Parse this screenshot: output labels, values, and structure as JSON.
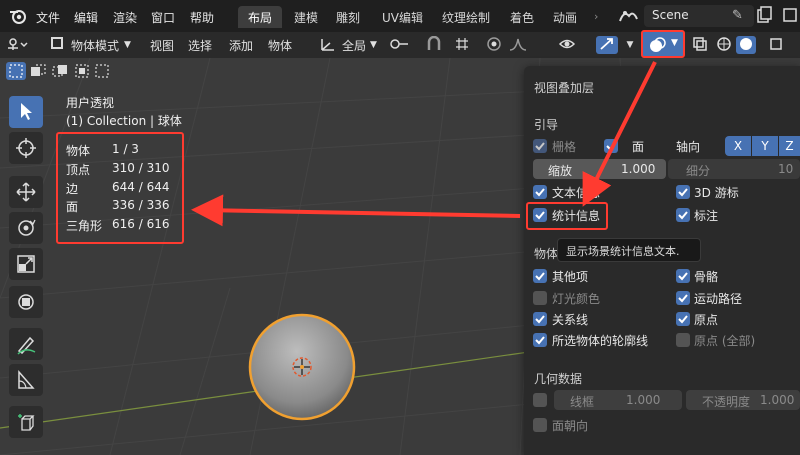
{
  "menubar": {
    "items": [
      "文件",
      "编辑",
      "渲染",
      "窗口",
      "帮助"
    ],
    "workspaces": [
      "布局",
      "建模",
      "雕刻",
      "UV编辑",
      "纹理绘制",
      "着色",
      "动画"
    ],
    "active_workspace": "布局",
    "scene": "Scene"
  },
  "toolbar": {
    "mode": "物体模式",
    "menus": [
      "视图",
      "选择",
      "添加",
      "物体"
    ],
    "orientation": "全局"
  },
  "viewport": {
    "view_name": "用户透视",
    "collection": "(1) Collection | 球体",
    "stats": [
      {
        "label": "物体",
        "value": "1 / 3"
      },
      {
        "label": "顶点",
        "value": "310 / 310"
      },
      {
        "label": "边",
        "value": "644 / 644"
      },
      {
        "label": "面",
        "value": "336 / 336"
      },
      {
        "label": "三角形",
        "value": "616 / 616"
      }
    ]
  },
  "overlay_panel": {
    "title": "视图叠加层",
    "guides": {
      "section": "引导",
      "grid": "栅格",
      "floor_partial": "面",
      "axis_label": "轴向",
      "axes": [
        "X",
        "Y",
        "Z"
      ],
      "scale_label": "缩放",
      "scale_value": "1.000",
      "subdiv_label": "细分",
      "subdiv_value": "10",
      "text_info": "文本信息",
      "cursor_3d": "3D 游标",
      "statistics": "统计信息",
      "annotations": "标注"
    },
    "objects": {
      "section_partial": "物体",
      "extras": "其他项",
      "bones": "骨骼",
      "light_colors": "灯光颜色",
      "motion_paths": "运动路径",
      "relationship_lines": "关系线",
      "origins": "原点",
      "outline_selected": "所选物体的轮廓线",
      "origins_all": "原点 (全部)"
    },
    "geometry": {
      "section": "几何数据",
      "wireframe_label": "线框",
      "wireframe_value": "1.000",
      "opacity_label": "不透明度",
      "opacity_value": "1.000",
      "face_orientation": "面朝向"
    },
    "tooltip": "显示场景统计信息文本."
  },
  "colors": {
    "accent": "#4772b3",
    "highlight": "#ff3b30",
    "selection_orange": "#f0a030"
  }
}
